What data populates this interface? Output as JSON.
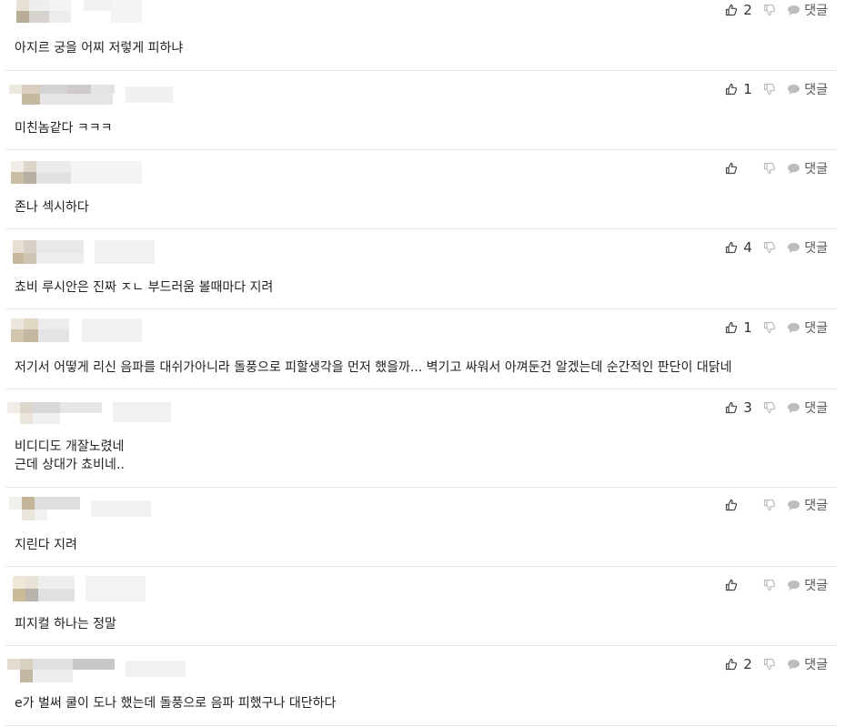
{
  "reply_label": "댓글",
  "comments": [
    {
      "likes": "2",
      "text": "아지르 궁을 어찌 저렇게 피하냐"
    },
    {
      "likes": "1",
      "text": "미친놈같다 ㅋㅋㅋ"
    },
    {
      "likes": "",
      "text": "존나 섹시하다"
    },
    {
      "likes": "4",
      "text": "쵸비 루시안은 진짜 ㅈㄴ 부드러움 볼때마다 지려"
    },
    {
      "likes": "1",
      "text": "저기서 어떻게 리신 음파를 대쉬가아니라 돌풍으로 피할생각을 먼저 했을까... 벽기고 싸워서 아껴둔건 알겠는데 순간적인 판단이 대닭네"
    },
    {
      "likes": "3",
      "text": "비디디도 개잘노렸네\n근데 상대가 쵸비네.."
    },
    {
      "likes": "",
      "text": "지린다 지려"
    },
    {
      "likes": "",
      "text": "피지컬 하나는 정말"
    },
    {
      "likes": "2",
      "text": "e가 벌써 쿨이 도나 했는데 돌풍으로 음파 피했구나 대단하다"
    }
  ]
}
